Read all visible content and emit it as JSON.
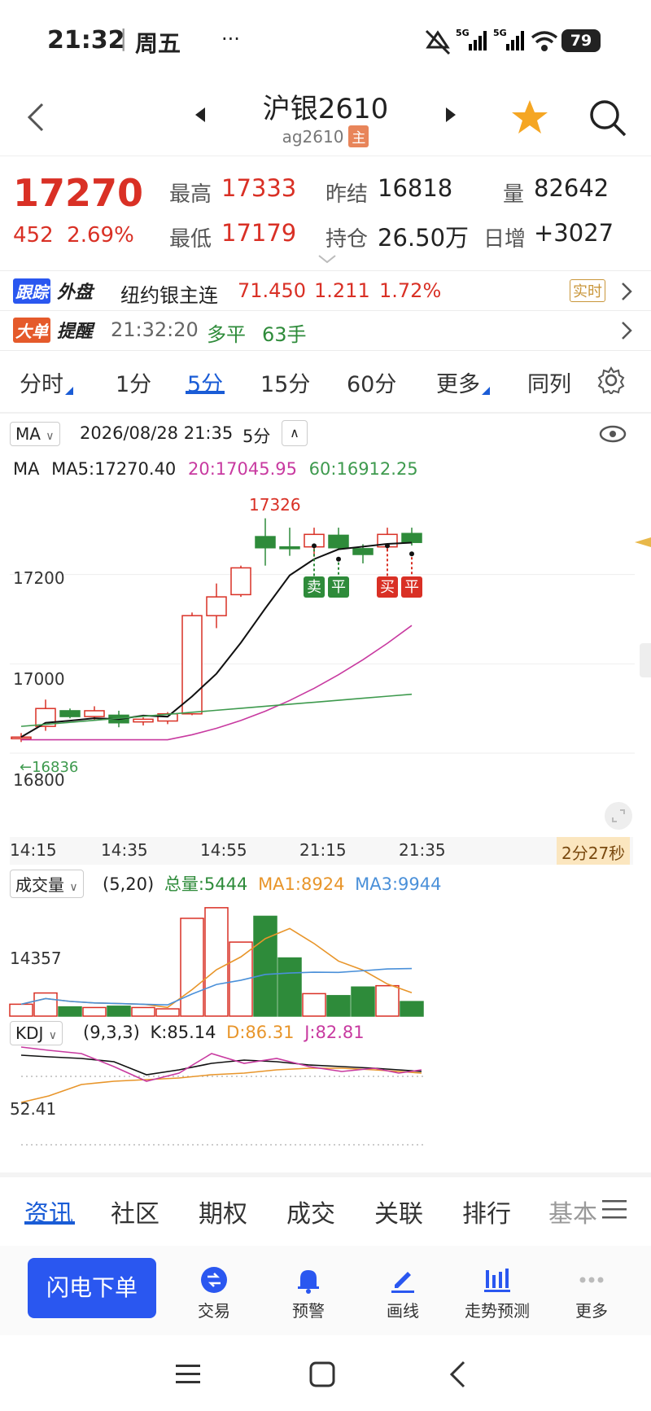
{
  "status": {
    "time": "21:32",
    "day": "周五",
    "dots": "···",
    "battery": "79"
  },
  "nav": {
    "title": "沪银2610",
    "subtitle": "ag2610",
    "badge": "主"
  },
  "quote": {
    "last": "17270",
    "change": "452",
    "change_pct": "2.69%",
    "high_label": "最高",
    "high": "17333",
    "low_label": "最低",
    "low": "17179",
    "prev_settle_label": "昨结",
    "prev_settle": "16818",
    "position_label": "持仓",
    "position": "26.50万",
    "volume_label": "量",
    "volume": "82642",
    "daily_inc_label": "日增",
    "daily_inc": "+3027"
  },
  "outer": {
    "tag1": "跟踪",
    "tag2": "外盘",
    "name": "纽约银主连",
    "price": "71.450",
    "chg": "1.211",
    "pct": "1.72%",
    "live": "实时"
  },
  "alert": {
    "tag1": "大单",
    "tag2": "提醒",
    "time": "21:32:20",
    "action": "多平",
    "qty": "63手"
  },
  "tabs": [
    "分时",
    "1分",
    "5分",
    "15分",
    "60分",
    "更多",
    "同列"
  ],
  "chart_header": {
    "indicator": "MA",
    "datetime": "2026/08/28 21:35",
    "period": "5分"
  },
  "ma_line": {
    "label": "MA",
    "ma5": "MA5:17270.40",
    "ma20": "20:17045.95",
    "ma60": "60:16912.25"
  },
  "price_axis": {
    "y1": "17200",
    "y2": "17000",
    "y3": "16800",
    "low_marker": "←16836",
    "high_marker": "17326"
  },
  "time_axis": [
    "14:15",
    "14:35",
    "14:55",
    "21:15",
    "21:35"
  ],
  "countdown": "2分27秒",
  "signals": [
    "卖",
    "平",
    "买",
    "平"
  ],
  "volume": {
    "label": "成交量",
    "params": "(5,20)",
    "total": "总量:5444",
    "ma1": "MA1:8924",
    "ma3": "MA3:9944",
    "axis": "14357"
  },
  "kdj": {
    "label": "KDJ",
    "params": "(9,3,3)",
    "k": "K:85.14",
    "d": "D:86.31",
    "j": "J:82.81",
    "axis": "52.41"
  },
  "news_tabs": [
    "资讯",
    "社区",
    "期权",
    "成交",
    "关联",
    "排行",
    "基本"
  ],
  "actions": {
    "flash": "闪电下单",
    "items": [
      "交易",
      "预警",
      "画线",
      "走势预测",
      "更多"
    ]
  },
  "colors": {
    "up": "#d93025",
    "down": "#2e8b3a",
    "accent": "#1a5cd6",
    "ma20": "#c83aa0",
    "ma60": "#3e9a4e",
    "vol_ma1": "#e8952a",
    "vol_ma3": "#4a90d9"
  },
  "chart_data": {
    "type": "candlestick",
    "x": [
      "14:15",
      "14:20",
      "14:25",
      "14:30",
      "14:35",
      "14:40",
      "14:45",
      "14:50",
      "14:55",
      "15:00",
      "21:00",
      "21:05",
      "21:10",
      "21:15",
      "21:20",
      "21:25",
      "21:30",
      "21:35"
    ],
    "candles": [
      {
        "o": 16836,
        "c": 16836,
        "h": 16845,
        "l": 16825
      },
      {
        "o": 16860,
        "c": 16900,
        "h": 16920,
        "l": 16850
      },
      {
        "o": 16895,
        "c": 16882,
        "h": 16900,
        "l": 16878
      },
      {
        "o": 16882,
        "c": 16895,
        "h": 16905,
        "l": 16875
      },
      {
        "o": 16885,
        "c": 16868,
        "h": 16895,
        "l": 16858
      },
      {
        "o": 16870,
        "c": 16876,
        "h": 16880,
        "l": 16862
      },
      {
        "o": 16872,
        "c": 16888,
        "h": 16892,
        "l": 16865
      },
      {
        "o": 16888,
        "c": 17108,
        "h": 17115,
        "l": 16885
      },
      {
        "o": 17108,
        "c": 17150,
        "h": 17180,
        "l": 17080
      },
      {
        "o": 17155,
        "c": 17215,
        "h": 17220,
        "l": 17150
      },
      {
        "o": 17285,
        "c": 17260,
        "h": 17326,
        "l": 17220
      },
      {
        "o": 17262,
        "c": 17258,
        "h": 17305,
        "l": 17242
      },
      {
        "o": 17262,
        "c": 17290,
        "h": 17305,
        "l": 17240
      },
      {
        "o": 17288,
        "c": 17260,
        "h": 17305,
        "l": 17255
      },
      {
        "o": 17258,
        "c": 17245,
        "h": 17268,
        "l": 17225
      },
      {
        "o": 17262,
        "c": 17290,
        "h": 17305,
        "l": 17255
      },
      {
        "o": 17292,
        "c": 17272,
        "h": 17305,
        "l": 17265
      }
    ],
    "ylim": [
      16780,
      17400
    ],
    "volume_values": [
      1800,
      3500,
      1400,
      1300,
      1500,
      1300,
      1100,
      14800,
      16400,
      11200,
      15100,
      8800,
      3400,
      3100,
      4400,
      4600,
      2200
    ],
    "y_ticks": [
      17200,
      17000,
      16800
    ]
  }
}
